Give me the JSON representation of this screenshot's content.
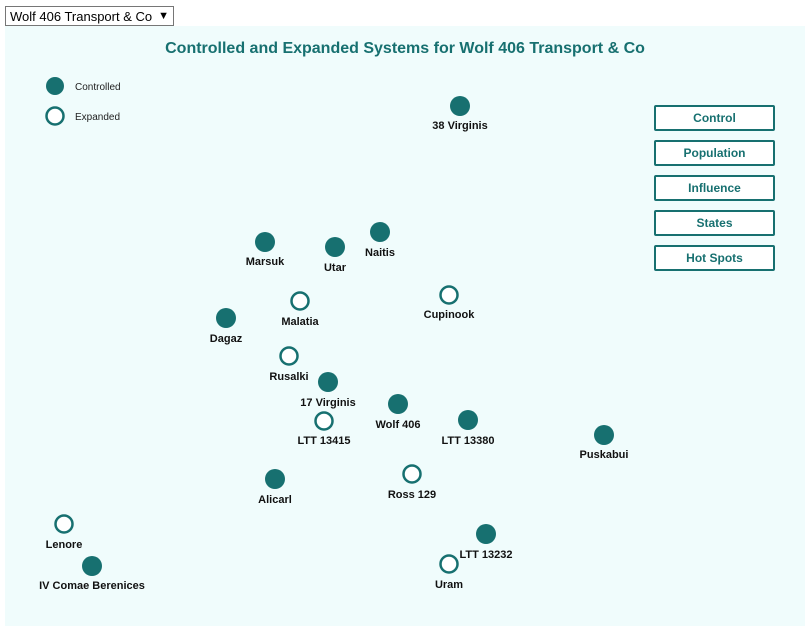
{
  "faction_select": {
    "selected": "Wolf 406 Transport & Co"
  },
  "map": {
    "title": "Controlled and Expanded Systems for Wolf 406 Transport & Co",
    "accent_color": "#177070",
    "background_color": "#f0fcfc",
    "legend": [
      {
        "label": "Controlled",
        "marker": "filled"
      },
      {
        "label": "Expanded",
        "marker": "hollow"
      }
    ],
    "systems": [
      {
        "name": "38 Virginis",
        "status": "controlled"
      },
      {
        "name": "Marsuk",
        "status": "controlled"
      },
      {
        "name": "Utar",
        "status": "controlled"
      },
      {
        "name": "Naitis",
        "status": "controlled"
      },
      {
        "name": "Malatia",
        "status": "expanded"
      },
      {
        "name": "Cupinook",
        "status": "expanded"
      },
      {
        "name": "Dagaz",
        "status": "controlled"
      },
      {
        "name": "Rusalki",
        "status": "expanded"
      },
      {
        "name": "17 Virginis",
        "status": "controlled"
      },
      {
        "name": "Wolf 406",
        "status": "controlled"
      },
      {
        "name": "LTT 13415",
        "status": "expanded"
      },
      {
        "name": "LTT 13380",
        "status": "controlled"
      },
      {
        "name": "Puskabui",
        "status": "controlled"
      },
      {
        "name": "Ross 129",
        "status": "expanded"
      },
      {
        "name": "Alicarl",
        "status": "controlled"
      },
      {
        "name": "Lenore",
        "status": "expanded"
      },
      {
        "name": "LTT 13232",
        "status": "controlled"
      },
      {
        "name": "IV Comae Berenices",
        "status": "controlled"
      },
      {
        "name": "Uram",
        "status": "expanded"
      }
    ]
  },
  "buttons": [
    {
      "label": "Control"
    },
    {
      "label": "Population"
    },
    {
      "label": "Influence"
    },
    {
      "label": "States"
    },
    {
      "label": "Hot Spots"
    }
  ]
}
